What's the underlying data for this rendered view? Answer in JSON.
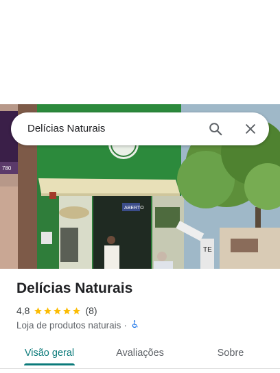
{
  "search": {
    "query": "Delícias Naturais",
    "search_icon": "search-icon",
    "close_icon": "close-icon"
  },
  "photo": {
    "sign_text": "ABERTO",
    "phone_fragment": "780"
  },
  "place": {
    "name": "Delícias Naturais",
    "rating": "4,8",
    "stars": 5,
    "review_count": "(8)",
    "category": "Loja de produtos naturais",
    "separator": "·",
    "accessibility_icon": "wheelchair-icon"
  },
  "tabs": [
    {
      "label": "Visão geral",
      "active": true
    },
    {
      "label": "Avaliações",
      "active": false
    },
    {
      "label": "Sobre",
      "active": false
    }
  ],
  "colors": {
    "accent": "#0b7a7a",
    "star": "#fbbc04",
    "accessibility": "#1a73e8"
  }
}
